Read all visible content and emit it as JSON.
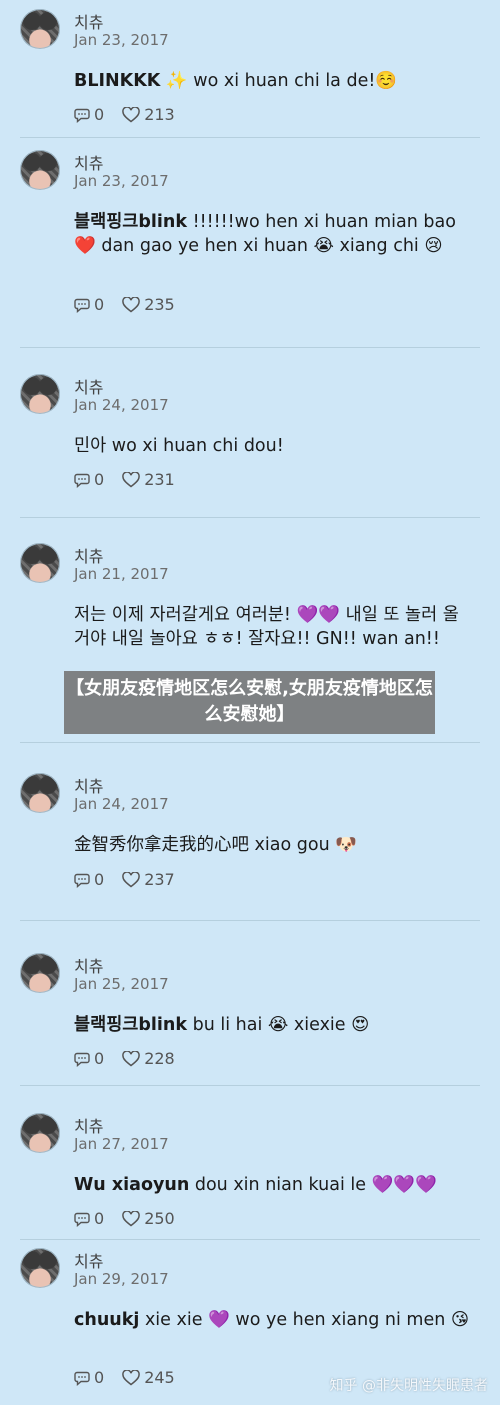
{
  "posts": [
    {
      "user": "치츄",
      "date": "Jan 23, 2017",
      "mention": "BLINKKK",
      "before": "",
      "text": " ✨ wo xi huan chi la de!☺️",
      "comments": "0",
      "likes": "213"
    },
    {
      "user": "치츄",
      "date": "Jan 23, 2017",
      "mention": "블랙핑크blink",
      "before": "",
      "text": " !!!!!!wo hen xi huan mian bao ❤️ dan gao ye hen xi huan 😭 xiang chi 😢",
      "comments": "0",
      "likes": "235"
    },
    {
      "user": "치츄",
      "date": "Jan 24, 2017",
      "mention": "",
      "before": "민아 wo xi huan chi dou!",
      "text": "",
      "comments": "0",
      "likes": "231"
    },
    {
      "user": "치츄",
      "date": "Jan 21, 2017",
      "mention": "",
      "before": "저는 이제 자러갈게요 여러분! 💜💜 내일 또 놀러 올거야 내일 놀아요 ㅎㅎ! 잘자요!! GN!! wan an!!",
      "text": "",
      "comments": "",
      "likes": ""
    },
    {
      "user": "치츄",
      "date": "Jan 24, 2017",
      "mention": "",
      "before": "金智秀你拿走我的心吧 xiao gou 🐶",
      "text": "",
      "comments": "0",
      "likes": "237"
    },
    {
      "user": "치츄",
      "date": "Jan 25, 2017",
      "mention": "블랙핑크blink",
      "before": "",
      "text": " bu li hai 😭 xiexie 😍",
      "comments": "0",
      "likes": "228"
    },
    {
      "user": "치츄",
      "date": "Jan 27, 2017",
      "mention": "Wu xiaoyun",
      "before": "",
      "text": " dou xin nian kuai le 💜💜💜",
      "comments": "0",
      "likes": "250"
    },
    {
      "user": "치츄",
      "date": "Jan 29, 2017",
      "mention": "chuukj",
      "before": "",
      "text": " xie xie 💜 wo ye hen xiang ni men 😘",
      "comments": "0",
      "likes": "245"
    }
  ],
  "banner": "【女朋友疫情地区怎么安慰,女朋友疫情地区怎么安慰她】",
  "watermark": "知乎 @非失明性失眠患者",
  "colors": {
    "background": "#cfe7f7",
    "banner": "#737373"
  }
}
